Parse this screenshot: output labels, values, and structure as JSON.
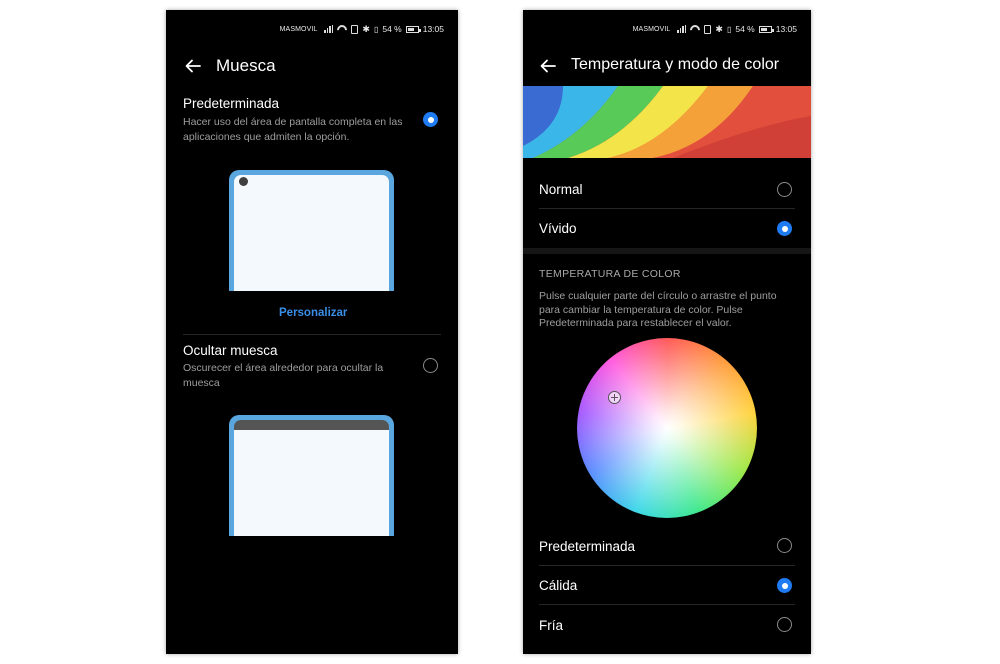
{
  "status_bar": {
    "carrier": "MASMOVIL",
    "battery": "54 %",
    "time": "13:05"
  },
  "left_screen": {
    "title": "Muesca",
    "option_default": {
      "title": "Predeterminada",
      "description": "Hacer uso del área de pantalla completa en las aplicaciones que admiten la opción.",
      "selected": true
    },
    "customize_link": "Personalizar",
    "option_hide": {
      "title": "Ocultar muesca",
      "description": "Oscurecer el área alrededor para ocultar la muesca",
      "selected": false
    }
  },
  "right_screen": {
    "title": "Temperatura y modo de color",
    "modes": [
      {
        "label": "Normal",
        "selected": false
      },
      {
        "label": "Vívido",
        "selected": true
      }
    ],
    "section_title": "TEMPERATURA DE COLOR",
    "section_description": "Pulse cualquier parte del círculo o arrastre el punto para cambiar la temperatura de color. Pulse Predeterminada para restablecer el valor.",
    "temperatures": [
      {
        "label": "Predeterminada",
        "selected": false
      },
      {
        "label": "Cálida",
        "selected": true
      },
      {
        "label": "Fría",
        "selected": false
      }
    ]
  },
  "icons": [
    "back-arrow-icon",
    "signal-icon",
    "wifi-icon",
    "sim-icon",
    "bluetooth-icon",
    "vibrate-icon",
    "battery-icon",
    "color-picker-icon"
  ],
  "colors": {
    "accent": "#1e7bf2",
    "link": "#3a8ee6",
    "background": "#000000",
    "illustration": "#5aa7e0"
  }
}
